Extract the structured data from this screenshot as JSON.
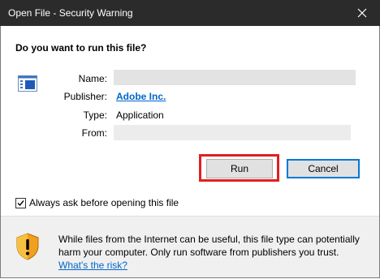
{
  "window": {
    "title": "Open File - Security Warning",
    "close_glyph": "✕"
  },
  "dialog": {
    "question": "Do you want to run this file?",
    "fields": {
      "name_label": "Name:",
      "publisher_label": "Publisher:",
      "publisher_value": "Adobe Inc.",
      "type_label": "Type:",
      "type_value": "Application",
      "from_label": "From:"
    }
  },
  "buttons": {
    "run_label": "Run",
    "cancel_label": "Cancel"
  },
  "checkbox": {
    "label": "Always ask before opening this file",
    "checked": true
  },
  "footer": {
    "warning_text": "While files from the Internet can be useful, this file type can potentially harm your computer. Only run software from publishers you trust.",
    "risk_link": "What's the risk?"
  },
  "colors": {
    "titlebar": "#2b2b2b",
    "link": "#0066cc",
    "highlight": "#e02020",
    "shield_orange": "#f0a020"
  }
}
